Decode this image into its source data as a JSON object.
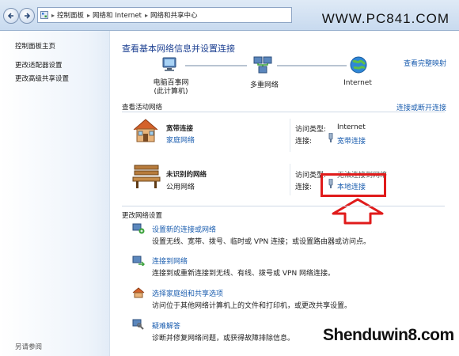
{
  "breadcrumb": {
    "items": [
      "控制面板",
      "网络和 Internet",
      "网络和共享中心"
    ]
  },
  "watermark_top": "WWW.PC841.COM",
  "watermark_bottom": "Shenduwin8.com",
  "sidebar": {
    "items": [
      {
        "label": "控制面板主页"
      },
      {
        "label": "更改适配器设置"
      },
      {
        "label": "更改高级共享设置"
      }
    ],
    "see_also": "另请参阅"
  },
  "main": {
    "title": "查看基本网络信息并设置连接",
    "full_map_link": "查看完整映射",
    "map": {
      "computer_label1": "电脑百事网",
      "computer_label2": "(此计算机)",
      "network_label": "多重网络",
      "internet_label": "Internet"
    },
    "active_title": "查看活动网络",
    "connect_link": "连接或断开连接",
    "networks": [
      {
        "name": "宽带连接",
        "type": "家庭网络",
        "access_label": "访问类型:",
        "access_value": "Internet",
        "conn_label": "连接:",
        "conn_value": "宽带连接"
      },
      {
        "name": "未识别的网络",
        "type": "公用网络",
        "access_label": "访问类型:",
        "access_value": "无法连接到网络",
        "conn_label": "连接:",
        "conn_value": "本地连接"
      }
    ],
    "change_title": "更改网络设置",
    "tasks": [
      {
        "title": "设置新的连接或网络",
        "desc": "设置无线、宽带、拨号、临时或 VPN 连接；或设置路由器或访问点。"
      },
      {
        "title": "连接到网络",
        "desc": "连接到或重新连接到无线、有线、拨号或 VPN 网络连接。"
      },
      {
        "title": "选择家庭组和共享选项",
        "desc": "访问位于其他网络计算机上的文件和打印机，或更改共享设置。"
      },
      {
        "title": "疑难解答",
        "desc": "诊断并修复网络问题，或获得故障排除信息。"
      }
    ]
  },
  "colors": {
    "link": "#1d5fb0",
    "title": "#1b3f91",
    "highlight": "#e01b1b"
  }
}
